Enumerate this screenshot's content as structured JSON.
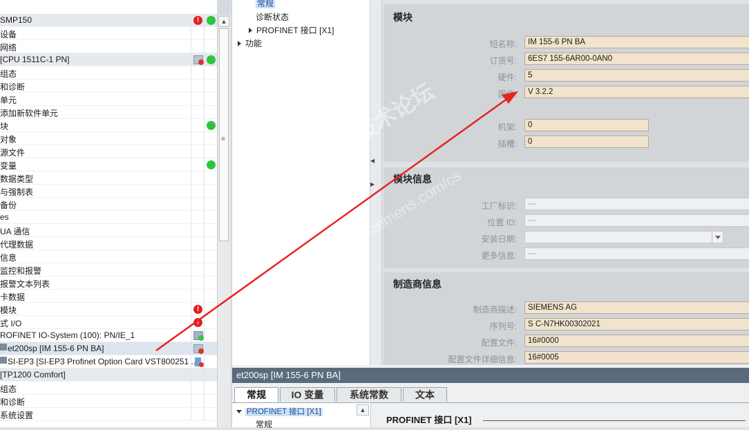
{
  "tree": {
    "rows": [
      {
        "label": "SMP150",
        "status1": "err",
        "status2": "ok",
        "style": "hl"
      },
      {
        "label": "设备",
        "status1": "",
        "status2": "",
        "style": ""
      },
      {
        "label": "网络",
        "status1": "",
        "status2": "",
        "style": ""
      },
      {
        "label": "[CPU 1511C-1 PN]",
        "status1": "dev",
        "status2": "ok",
        "style": "hl"
      },
      {
        "label": "组态",
        "status1": "",
        "status2": "",
        "style": ""
      },
      {
        "label": "和诊断",
        "status1": "",
        "status2": "",
        "style": ""
      },
      {
        "label": "单元",
        "status1": "",
        "status2": "",
        "style": ""
      },
      {
        "label": "添加新软件单元",
        "status1": "",
        "status2": "",
        "style": ""
      },
      {
        "label": "块",
        "status1": "",
        "status2": "ok",
        "style": ""
      },
      {
        "label": "对象",
        "status1": "",
        "status2": "",
        "style": ""
      },
      {
        "label": "源文件",
        "status1": "",
        "status2": "",
        "style": ""
      },
      {
        "label": "变量",
        "status1": "",
        "status2": "ok",
        "style": ""
      },
      {
        "label": "数据类型",
        "status1": "",
        "status2": "",
        "style": ""
      },
      {
        "label": "与强制表",
        "status1": "",
        "status2": "",
        "style": ""
      },
      {
        "label": "备份",
        "status1": "",
        "status2": "",
        "style": ""
      },
      {
        "label": "es",
        "status1": "",
        "status2": "",
        "style": ""
      },
      {
        "label": "UA 通信",
        "status1": "",
        "status2": "",
        "style": ""
      },
      {
        "label": "代理数据",
        "status1": "",
        "status2": "",
        "style": ""
      },
      {
        "label": "信息",
        "status1": "",
        "status2": "",
        "style": ""
      },
      {
        "label": "监控和报警",
        "status1": "",
        "status2": "",
        "style": ""
      },
      {
        "label": "报警文本列表",
        "status1": "",
        "status2": "",
        "style": ""
      },
      {
        "label": "卡数据",
        "status1": "",
        "status2": "",
        "style": ""
      },
      {
        "label": "模块",
        "status1": "err",
        "status2": "",
        "style": ""
      },
      {
        "label": "式 I/O",
        "status1": "err",
        "status2": "",
        "style": ""
      },
      {
        "label": "ROFINET IO-System (100): PN/IE_1",
        "status1": "chk",
        "status2": "",
        "style": ""
      },
      {
        "label": "et200sp [IM 155-6 PN BA]",
        "status1": "dev",
        "status2": "",
        "style": "sel"
      },
      {
        "label": "SI-EP3 [SI-EP3 Profinet Option Card VST800251 ...",
        "status1": "sm",
        "status2": "",
        "style": ""
      },
      {
        "label": "[TP1200 Comfort]",
        "status1": "",
        "status2": "",
        "style": "hl"
      },
      {
        "label": "组态",
        "status1": "",
        "status2": "",
        "style": ""
      },
      {
        "label": "和诊断",
        "status1": "",
        "status2": "",
        "style": ""
      },
      {
        "label": "系统设置",
        "status1": "",
        "status2": "",
        "style": ""
      }
    ]
  },
  "nav": {
    "general": "常规",
    "diag_status": "诊断状态",
    "profinet": "PROFINET 接口 [X1]",
    "function": "功能"
  },
  "props": {
    "module": {
      "title": "模块",
      "short_name_label": "短名称:",
      "short_name": "IM 155-6 PN BA",
      "order_label": "订货号:",
      "order_no": "6ES7 155-6AR00-0AN0",
      "hw_label": "硬件:",
      "hw": "5",
      "fw_label": "固件:",
      "fw": "V 3.2.2",
      "rack_label": "机架:",
      "rack": "0",
      "slot_label": "插槽:",
      "slot": "0"
    },
    "info": {
      "title": "模块信息",
      "plant_label": "工厂标识:",
      "plant": "---",
      "loc_label": "位置 ID:",
      "loc": "---",
      "date_label": "安装日期:",
      "more_label": "更多信息:",
      "more": "---"
    },
    "mfr": {
      "title": "制造商信息",
      "desc_label": "制造商描述:",
      "desc": "SIEMENS AG",
      "serial_label": "序列号:",
      "serial": "S C-N7HK00302021",
      "profile_label": "配置文件:",
      "profile": "16#0000",
      "profile_detail_label": "配置文件详细信息:",
      "profile_detail": "16#0005"
    }
  },
  "bottom": {
    "title": "et200sp [IM 155-6 PN BA]",
    "tabs": [
      "常规",
      "IO 变量",
      "系统常数",
      "文本"
    ],
    "nav_item": "PROFINET 接口 [X1]",
    "nav_sub": "常规",
    "main_heading": "PROFINET 接口 [X1]"
  },
  "watermark": {
    "line1": "西门子工业 技术论坛",
    "line2": "support.industry.siemens.com/cs"
  }
}
